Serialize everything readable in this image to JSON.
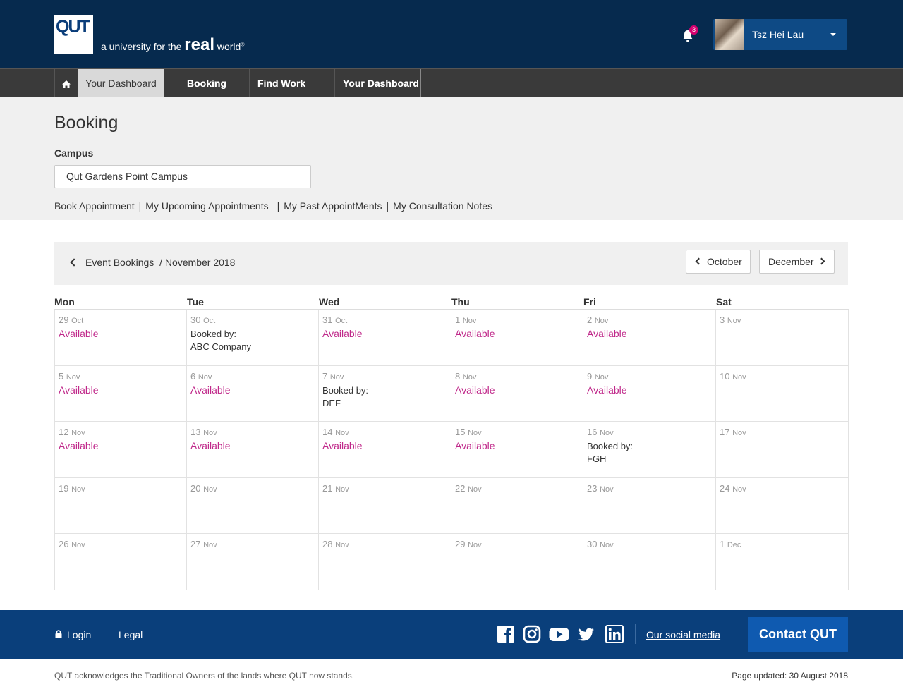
{
  "brand": {
    "logo_text": "QUT",
    "tagline_pre": "a university for the ",
    "tagline_real": "real",
    "tagline_world": " world",
    "tagline_mark": "®"
  },
  "header": {
    "notification_count": "3",
    "user_name": "Tsz Hei Lau"
  },
  "nav": {
    "items": [
      "Your Dashboard",
      "Booking",
      "Find Work",
      "Your Dashboard"
    ]
  },
  "page": {
    "title": "Booking",
    "campus_label": "Campus",
    "campus_value": "Qut Gardens Point Campus",
    "links": [
      "Book Appointment",
      "My Upcoming Appointments",
      "My Past AppointMents",
      "My Consultation Notes"
    ]
  },
  "calendar": {
    "crumb_parent": "Event Bookings",
    "crumb_current": "/ November 2018",
    "prev_label": "October",
    "next_label": "December",
    "days": [
      "Mon",
      "Tue",
      "Wed",
      "Thu",
      "Fri",
      "Sat"
    ],
    "weeks": [
      [
        {
          "d": "29",
          "m": "Oct",
          "status": "Available"
        },
        {
          "d": "30",
          "m": "Oct",
          "booked_label": "Booked by:",
          "booked_by": "ABC Company"
        },
        {
          "d": "31",
          "m": "Oct",
          "status": "Available"
        },
        {
          "d": "1",
          "m": "Nov",
          "status": "Available"
        },
        {
          "d": "2",
          "m": "Nov",
          "status": "Available"
        },
        {
          "d": "3",
          "m": "Nov"
        }
      ],
      [
        {
          "d": "5",
          "m": "Nov",
          "status": "Available"
        },
        {
          "d": "6",
          "m": "Nov",
          "status": "Available"
        },
        {
          "d": "7",
          "m": "Nov",
          "booked_label": "Booked by:",
          "booked_by": "DEF"
        },
        {
          "d": "8",
          "m": "Nov",
          "status": "Available"
        },
        {
          "d": "9",
          "m": "Nov",
          "status": "Available"
        },
        {
          "d": "10",
          "m": "Nov"
        }
      ],
      [
        {
          "d": "12",
          "m": "Nov",
          "status": "Available"
        },
        {
          "d": "13",
          "m": "Nov",
          "status": "Available"
        },
        {
          "d": "14",
          "m": "Nov",
          "status": "Available"
        },
        {
          "d": "15",
          "m": "Nov",
          "status": "Available"
        },
        {
          "d": "16",
          "m": "Nov",
          "booked_label": "Booked by:",
          "booked_by": "FGH"
        },
        {
          "d": "17",
          "m": "Nov"
        }
      ],
      [
        {
          "d": "19",
          "m": "Nov"
        },
        {
          "d": "20",
          "m": "Nov"
        },
        {
          "d": "21",
          "m": "Nov"
        },
        {
          "d": "22",
          "m": "Nov"
        },
        {
          "d": "23",
          "m": "Nov"
        },
        {
          "d": "24",
          "m": "Nov"
        }
      ],
      [
        {
          "d": "26",
          "m": "Nov"
        },
        {
          "d": "27",
          "m": "Nov"
        },
        {
          "d": "28",
          "m": "Nov"
        },
        {
          "d": "29",
          "m": "Nov"
        },
        {
          "d": "30",
          "m": "Nov"
        },
        {
          "d": "1",
          "m": "Dec"
        }
      ]
    ]
  },
  "footer": {
    "login": "Login",
    "legal": "Legal",
    "social_link": "Our social media",
    "social_icons": [
      "facebook-icon",
      "instagram-icon",
      "youtube-icon",
      "twitter-icon",
      "linkedin-icon"
    ],
    "contact": "Contact QUT",
    "acknowledgement": "QUT acknowledges the Traditional Owners of the lands where QUT now stands.",
    "updated": "Page updated: 30 August 2018"
  },
  "colors": {
    "header_bg": "#062a4e",
    "footer_bg": "#0a3f7b",
    "available": "#c0288a",
    "badge": "#d6006f"
  }
}
